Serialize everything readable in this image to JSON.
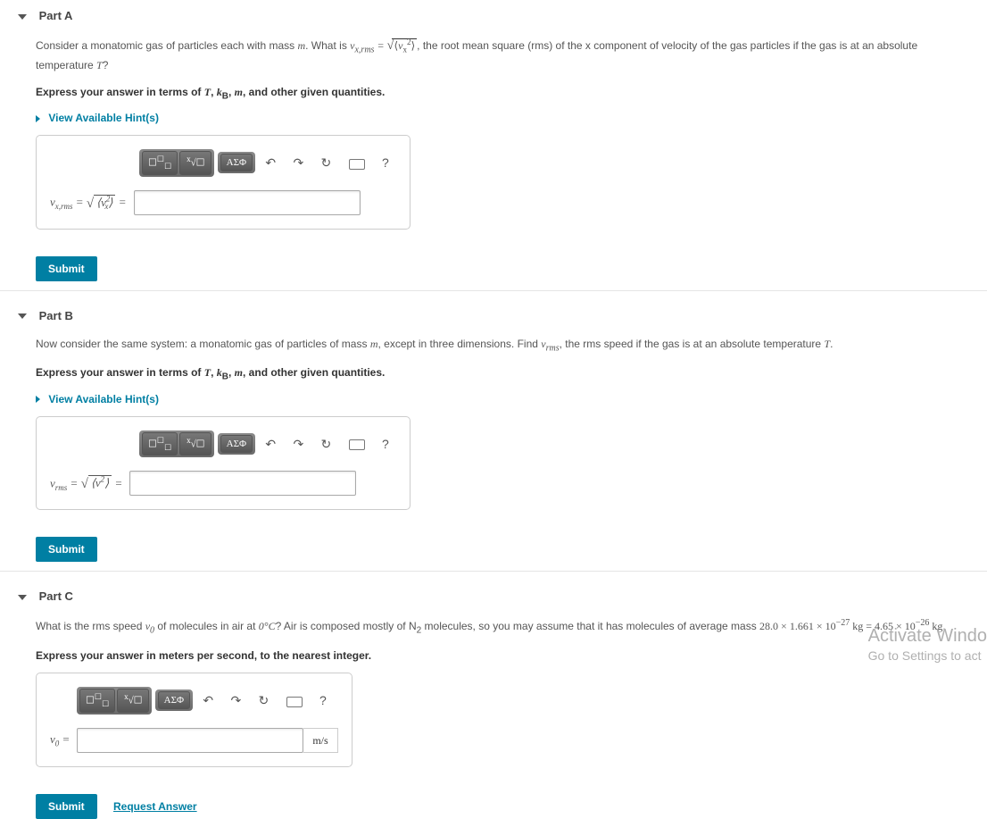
{
  "partA": {
    "title": "Part A",
    "question_pre": "Consider a monatomic gas of particles each with mass ",
    "question_mid": ". What is ",
    "question_post": ", the root mean square (rms) of the x component of velocity of the gas particles if the gas is at an absolute temperature ",
    "question_end": "?",
    "express": "Express your answer in terms of T, k_B, m, and other given quantities.",
    "hints": "View Available Hint(s)",
    "lhs_var": "v",
    "lhs_sub": "x,rms",
    "submit": "Submit"
  },
  "partB": {
    "title": "Part B",
    "question_pre": "Now consider the same system: a monatomic gas of particles of mass ",
    "question_mid": ", except in three dimensions. Find ",
    "question_post": ", the rms speed if the gas is at an absolute temperature ",
    "question_end": ".",
    "express": "Express your answer in terms of T, k_B, m, and other given quantities.",
    "hints": "View Available Hint(s)",
    "lhs_var": "v",
    "lhs_sub": "rms",
    "submit": "Submit"
  },
  "partC": {
    "title": "Part C",
    "question_pre": "What is the rms speed ",
    "question_mid": " of molecules in air at ",
    "question_post": "? Air is composed mostly of ",
    "question_tail": " molecules, so you may assume that it has molecules of average mass ",
    "mass_text": "28.0 × 1.661 × 10⁻²⁷ kg = 4.65 × 10⁻²⁶ kg",
    "question_end": ".",
    "express": "Express your answer in meters per second, to the nearest integer.",
    "lhs": "v₀ =",
    "unit": "m/s",
    "submit": "Submit",
    "request": "Request Answer"
  },
  "toolbar": {
    "template": "■",
    "root": "ᵡ√☐",
    "greek": "ΑΣΦ",
    "undo": "↶",
    "redo": "↷",
    "reset": "↻",
    "help": "?"
  },
  "watermark": {
    "line1": "Activate Windo",
    "line2": "Go to Settings to act"
  }
}
